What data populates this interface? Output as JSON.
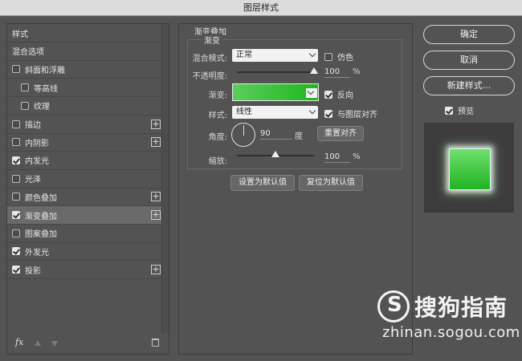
{
  "window": {
    "title": "图层样式"
  },
  "left_list": {
    "items": [
      {
        "label": "样式",
        "checkbox": false,
        "checked": false,
        "plus": false,
        "indent": 0,
        "selected": false
      },
      {
        "label": "混合选项",
        "checkbox": false,
        "checked": false,
        "plus": false,
        "indent": 0,
        "selected": false
      },
      {
        "label": "斜面和浮雕",
        "checkbox": true,
        "checked": false,
        "plus": false,
        "indent": 0,
        "selected": false
      },
      {
        "label": "等高线",
        "checkbox": true,
        "checked": false,
        "plus": false,
        "indent": 1,
        "selected": false
      },
      {
        "label": "纹理",
        "checkbox": true,
        "checked": false,
        "plus": false,
        "indent": 1,
        "selected": false
      },
      {
        "label": "描边",
        "checkbox": true,
        "checked": false,
        "plus": true,
        "indent": 0,
        "selected": false
      },
      {
        "label": "内阴影",
        "checkbox": true,
        "checked": false,
        "plus": true,
        "indent": 0,
        "selected": false
      },
      {
        "label": "内发光",
        "checkbox": true,
        "checked": true,
        "plus": false,
        "indent": 0,
        "selected": false
      },
      {
        "label": "光泽",
        "checkbox": true,
        "checked": false,
        "plus": false,
        "indent": 0,
        "selected": false
      },
      {
        "label": "颜色叠加",
        "checkbox": true,
        "checked": false,
        "plus": true,
        "indent": 0,
        "selected": false
      },
      {
        "label": "渐变叠加",
        "checkbox": true,
        "checked": true,
        "plus": true,
        "indent": 0,
        "selected": true
      },
      {
        "label": "图案叠加",
        "checkbox": true,
        "checked": false,
        "plus": false,
        "indent": 0,
        "selected": false
      },
      {
        "label": "外发光",
        "checkbox": true,
        "checked": true,
        "plus": false,
        "indent": 0,
        "selected": false
      },
      {
        "label": "投影",
        "checkbox": true,
        "checked": true,
        "plus": true,
        "indent": 0,
        "selected": false
      }
    ],
    "footer": {
      "fx_label": "fx"
    }
  },
  "gradient_overlay": {
    "section_title": "渐变叠加",
    "sub_title": "渐变",
    "blend_mode_label": "混合模式:",
    "blend_mode_value": "正常",
    "dither_label": "仿色",
    "dither_checked": false,
    "opacity_label": "不透明度:",
    "opacity_value": "100",
    "opacity_unit": "%",
    "opacity_level": 1.0,
    "gradient_label": "渐变:",
    "gradient_colors": [
      "#5ccc5c",
      "#1db71d"
    ],
    "reverse_label": "反向",
    "reverse_checked": true,
    "style_label": "样式:",
    "style_value": "线性",
    "align_label": "与图层对齐",
    "align_checked": true,
    "angle_label": "角度:",
    "angle_value": "90",
    "angle_unit": "度",
    "reset_align_label": "重置对齐",
    "scale_label": "缩放:",
    "scale_value": "100",
    "scale_unit": "%",
    "scale_level": 0.5,
    "set_default_label": "设置为默认值",
    "reset_default_label": "复位为默认值"
  },
  "right_panel": {
    "ok_label": "确定",
    "cancel_label": "取消",
    "new_style_label": "新建样式...",
    "preview_label": "预览",
    "preview_checked": true
  },
  "watermark": {
    "brand_text": "搜狗指南",
    "url_text": "zhinan.sogou.com"
  }
}
